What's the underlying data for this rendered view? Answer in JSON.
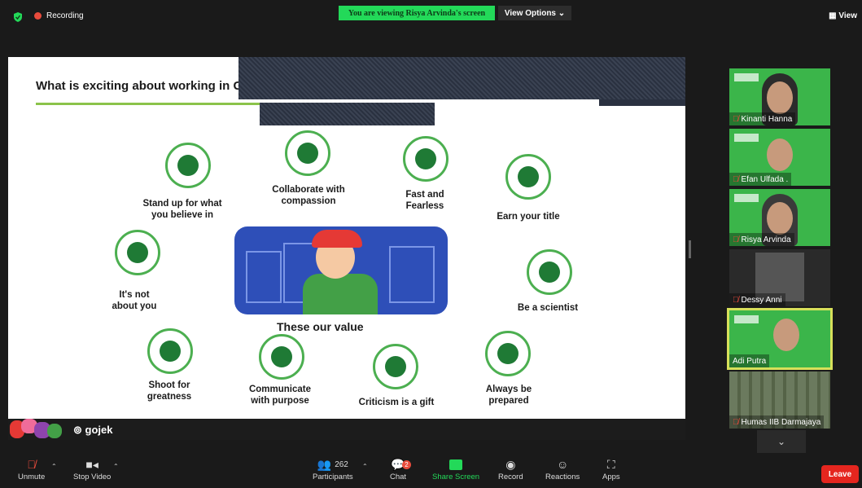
{
  "topbar": {
    "recording_label": "Recording",
    "viewing_banner": "You are viewing Risya Arvinda's screen",
    "view_options": "View Options ⌄",
    "view_button": "View",
    "view_icon": "grid-icon"
  },
  "slide": {
    "title": "What is exciting about working in G",
    "illustration_caption": "These our value",
    "footer_brand": "gojek",
    "values": [
      {
        "label": "Stand up for what\nyou believe in",
        "icon": "thought-person-icon"
      },
      {
        "label": "Collaborate with\ncompassion",
        "icon": "heart-icon"
      },
      {
        "label": "Fast and\nFearless",
        "icon": "lightning-badge-icon"
      },
      {
        "label": "Earn your title",
        "icon": "crown-icon"
      },
      {
        "label": "It's not\nabout you",
        "icon": "people-arrows-icon"
      },
      {
        "label": "Be a scientist",
        "icon": "lightbulb-icon"
      },
      {
        "label": "Shoot for\ngreatness",
        "icon": "trophy-icon"
      },
      {
        "label": "Communicate\nwith purpose",
        "icon": "chat-bubble-icon"
      },
      {
        "label": "Criticism is a gift",
        "icon": "gift-box-icon"
      },
      {
        "label": "Always be\nprepared",
        "icon": "check-screen-icon"
      }
    ],
    "colors": {
      "accent": "#4caf50",
      "icon_fill": "#1f7a35",
      "title_underline": "#8bc34a",
      "illustration_bg": "#2e4fb8"
    }
  },
  "participants": [
    {
      "name": "Kinanti Hanna",
      "muted": true
    },
    {
      "name": "Efan Ulfada .",
      "muted": true
    },
    {
      "name": "Risya Arvinda",
      "muted": true
    },
    {
      "name": "Dessy Anni",
      "muted": true
    },
    {
      "name": "Adi Putra",
      "muted": false,
      "active_speaker": true
    },
    {
      "name": "Humas IIB Darmajaya",
      "muted": true
    }
  ],
  "toolbar": {
    "unmute": "Unmute",
    "stop_video": "Stop Video",
    "participants_count": "262",
    "participants": "Participants",
    "chat": "Chat",
    "chat_badge": "2",
    "share_screen": "Share Screen",
    "record": "Record",
    "reactions": "Reactions",
    "apps": "Apps",
    "leave": "Leave"
  }
}
